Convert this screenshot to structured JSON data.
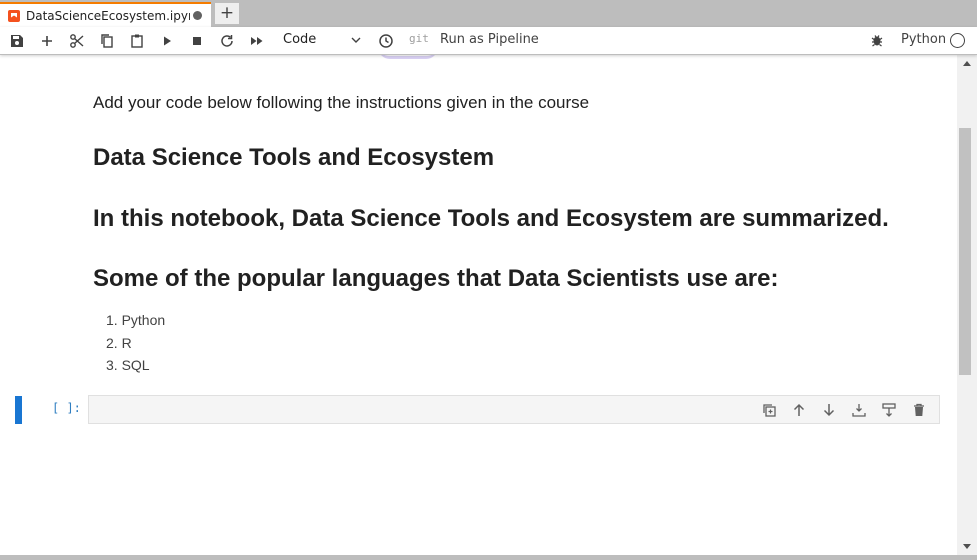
{
  "tab": {
    "title": "DataScienceEcosystem.ipyn",
    "add_label": "+"
  },
  "toolbar": {
    "cell_type": "Code",
    "git_label": "git",
    "pipeline_label": "Run as Pipeline",
    "kernel_name": "Python"
  },
  "notebook": {
    "instruction": "Add your code below following the instructions given in the course",
    "heading_title": "Data Science Tools and Ecosystem",
    "heading_intro": "In this notebook, Data Science Tools and Ecosystem are summarized.",
    "heading_languages": "Some of the popular languages that Data Scientists use are:",
    "languages": [
      "1. Python",
      "2. R",
      "3. SQL"
    ],
    "code_prompt": "[ ]:"
  },
  "colors": {
    "accent": "#1976d2",
    "tab_indicator": "#f57c00",
    "prompt": "#307fc1"
  },
  "icons": [
    "save-icon",
    "add-cell-icon",
    "cut-icon",
    "copy-icon",
    "paste-icon",
    "run-icon",
    "stop-icon",
    "restart-icon",
    "run-all-icon",
    "clock-icon",
    "bug-icon",
    "duplicate-cell-icon",
    "move-up-icon",
    "move-down-icon",
    "insert-below-icon",
    "insert-above-icon",
    "delete-icon"
  ]
}
